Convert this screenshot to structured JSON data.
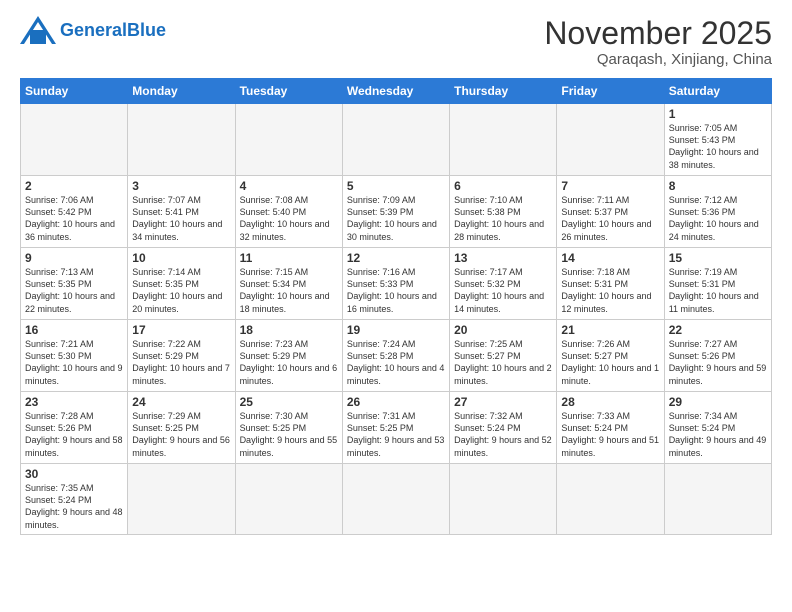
{
  "logo": {
    "text_general": "General",
    "text_blue": "Blue"
  },
  "title": "November 2025",
  "location": "Qaraqash, Xinjiang, China",
  "weekdays": [
    "Sunday",
    "Monday",
    "Tuesday",
    "Wednesday",
    "Thursday",
    "Friday",
    "Saturday"
  ],
  "days": [
    {
      "num": "",
      "info": ""
    },
    {
      "num": "",
      "info": ""
    },
    {
      "num": "",
      "info": ""
    },
    {
      "num": "",
      "info": ""
    },
    {
      "num": "",
      "info": ""
    },
    {
      "num": "",
      "info": ""
    },
    {
      "num": "1",
      "info": "Sunrise: 7:05 AM\nSunset: 5:43 PM\nDaylight: 10 hours\nand 38 minutes."
    },
    {
      "num": "2",
      "info": "Sunrise: 7:06 AM\nSunset: 5:42 PM\nDaylight: 10 hours\nand 36 minutes."
    },
    {
      "num": "3",
      "info": "Sunrise: 7:07 AM\nSunset: 5:41 PM\nDaylight: 10 hours\nand 34 minutes."
    },
    {
      "num": "4",
      "info": "Sunrise: 7:08 AM\nSunset: 5:40 PM\nDaylight: 10 hours\nand 32 minutes."
    },
    {
      "num": "5",
      "info": "Sunrise: 7:09 AM\nSunset: 5:39 PM\nDaylight: 10 hours\nand 30 minutes."
    },
    {
      "num": "6",
      "info": "Sunrise: 7:10 AM\nSunset: 5:38 PM\nDaylight: 10 hours\nand 28 minutes."
    },
    {
      "num": "7",
      "info": "Sunrise: 7:11 AM\nSunset: 5:37 PM\nDaylight: 10 hours\nand 26 minutes."
    },
    {
      "num": "8",
      "info": "Sunrise: 7:12 AM\nSunset: 5:36 PM\nDaylight: 10 hours\nand 24 minutes."
    },
    {
      "num": "9",
      "info": "Sunrise: 7:13 AM\nSunset: 5:35 PM\nDaylight: 10 hours\nand 22 minutes."
    },
    {
      "num": "10",
      "info": "Sunrise: 7:14 AM\nSunset: 5:35 PM\nDaylight: 10 hours\nand 20 minutes."
    },
    {
      "num": "11",
      "info": "Sunrise: 7:15 AM\nSunset: 5:34 PM\nDaylight: 10 hours\nand 18 minutes."
    },
    {
      "num": "12",
      "info": "Sunrise: 7:16 AM\nSunset: 5:33 PM\nDaylight: 10 hours\nand 16 minutes."
    },
    {
      "num": "13",
      "info": "Sunrise: 7:17 AM\nSunset: 5:32 PM\nDaylight: 10 hours\nand 14 minutes."
    },
    {
      "num": "14",
      "info": "Sunrise: 7:18 AM\nSunset: 5:31 PM\nDaylight: 10 hours\nand 12 minutes."
    },
    {
      "num": "15",
      "info": "Sunrise: 7:19 AM\nSunset: 5:31 PM\nDaylight: 10 hours\nand 11 minutes."
    },
    {
      "num": "16",
      "info": "Sunrise: 7:21 AM\nSunset: 5:30 PM\nDaylight: 10 hours\nand 9 minutes."
    },
    {
      "num": "17",
      "info": "Sunrise: 7:22 AM\nSunset: 5:29 PM\nDaylight: 10 hours\nand 7 minutes."
    },
    {
      "num": "18",
      "info": "Sunrise: 7:23 AM\nSunset: 5:29 PM\nDaylight: 10 hours\nand 6 minutes."
    },
    {
      "num": "19",
      "info": "Sunrise: 7:24 AM\nSunset: 5:28 PM\nDaylight: 10 hours\nand 4 minutes."
    },
    {
      "num": "20",
      "info": "Sunrise: 7:25 AM\nSunset: 5:27 PM\nDaylight: 10 hours\nand 2 minutes."
    },
    {
      "num": "21",
      "info": "Sunrise: 7:26 AM\nSunset: 5:27 PM\nDaylight: 10 hours\nand 1 minute."
    },
    {
      "num": "22",
      "info": "Sunrise: 7:27 AM\nSunset: 5:26 PM\nDaylight: 9 hours\nand 59 minutes."
    },
    {
      "num": "23",
      "info": "Sunrise: 7:28 AM\nSunset: 5:26 PM\nDaylight: 9 hours\nand 58 minutes."
    },
    {
      "num": "24",
      "info": "Sunrise: 7:29 AM\nSunset: 5:25 PM\nDaylight: 9 hours\nand 56 minutes."
    },
    {
      "num": "25",
      "info": "Sunrise: 7:30 AM\nSunset: 5:25 PM\nDaylight: 9 hours\nand 55 minutes."
    },
    {
      "num": "26",
      "info": "Sunrise: 7:31 AM\nSunset: 5:25 PM\nDaylight: 9 hours\nand 53 minutes."
    },
    {
      "num": "27",
      "info": "Sunrise: 7:32 AM\nSunset: 5:24 PM\nDaylight: 9 hours\nand 52 minutes."
    },
    {
      "num": "28",
      "info": "Sunrise: 7:33 AM\nSunset: 5:24 PM\nDaylight: 9 hours\nand 51 minutes."
    },
    {
      "num": "29",
      "info": "Sunrise: 7:34 AM\nSunset: 5:24 PM\nDaylight: 9 hours\nand 49 minutes."
    },
    {
      "num": "30",
      "info": "Sunrise: 7:35 AM\nSunset: 5:24 PM\nDaylight: 9 hours\nand 48 minutes."
    },
    {
      "num": "",
      "info": ""
    },
    {
      "num": "",
      "info": ""
    },
    {
      "num": "",
      "info": ""
    },
    {
      "num": "",
      "info": ""
    },
    {
      "num": "",
      "info": ""
    },
    {
      "num": "",
      "info": ""
    },
    {
      "num": "",
      "info": ""
    }
  ]
}
